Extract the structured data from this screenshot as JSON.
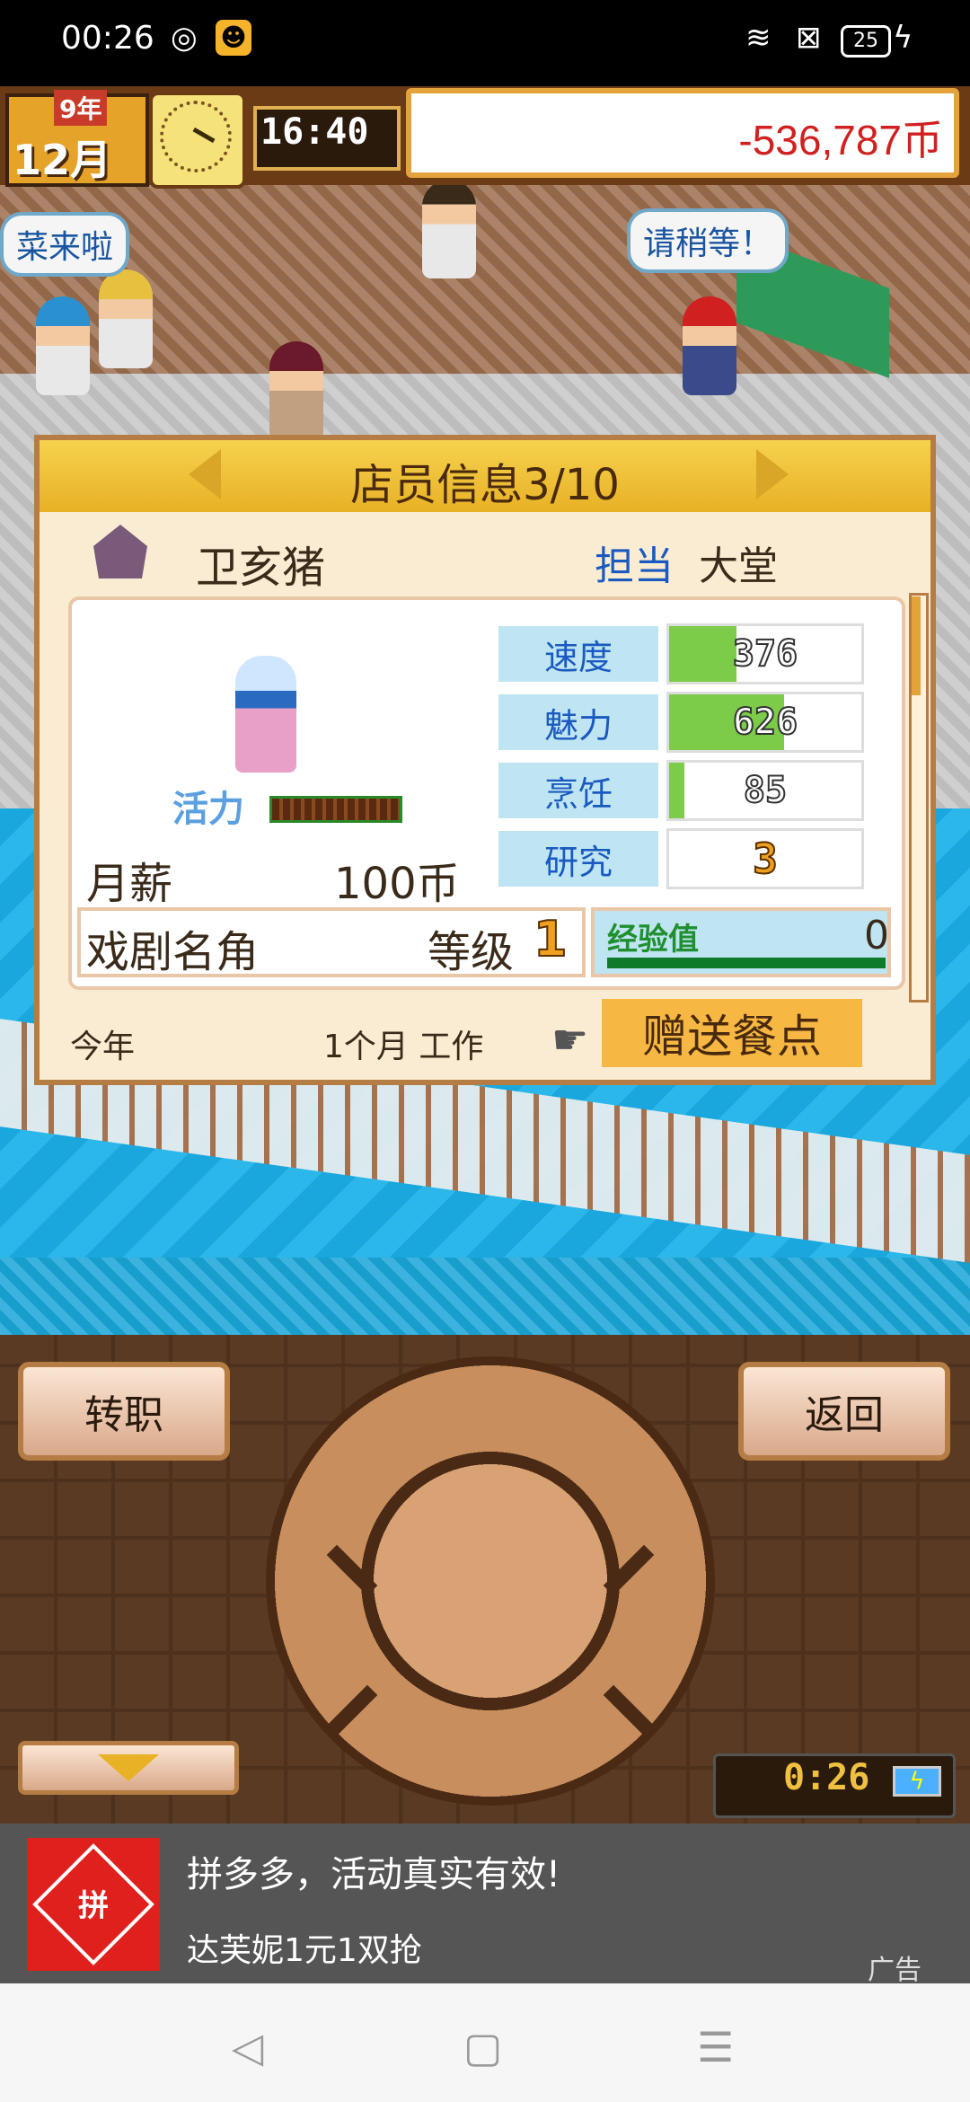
{
  "status_bar": {
    "time": "00:26",
    "battery": "25"
  },
  "hud": {
    "month": "12月",
    "year": "9年",
    "game_time": "16:40",
    "money": "-536,787币"
  },
  "bubbles": {
    "left": "菜来啦",
    "right": "请稍等！"
  },
  "staff_panel": {
    "title": "店员信息3/10",
    "name": "卫亥猪",
    "role_label": "担当",
    "role_value": "大堂",
    "vitality_label": "活力",
    "vitality_level": 1.0,
    "salary_label": "月薪",
    "salary_value": "100币",
    "stats": [
      {
        "name": "速度",
        "value": "376",
        "fill": 0.35
      },
      {
        "name": "魅力",
        "value": "626",
        "fill": 0.6
      },
      {
        "name": "烹饪",
        "value": "85",
        "fill": 0.08
      },
      {
        "name": "研究",
        "value": "3",
        "fill": 0.0
      }
    ],
    "skill": "戏剧名角",
    "level_label": "等级",
    "level_value": "1",
    "exp_label": "经验值",
    "exp_value": "0",
    "this_year": "今年",
    "work_time": "1个月 工作",
    "gift_button": "赠送餐点"
  },
  "controls": {
    "transfer": "转职",
    "back": "返回",
    "timer": "0:26"
  },
  "ad": {
    "logo_text": "拼",
    "title": "拼多多，活动真实有效!",
    "subtitle": "达芙妮1元1双抢",
    "tag": "广告"
  },
  "nav": {
    "back": "◁",
    "home": "▢",
    "menu": "☰"
  }
}
